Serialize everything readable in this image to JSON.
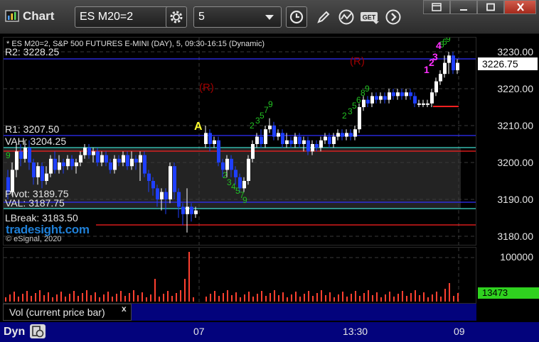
{
  "toolbar": {
    "app_title": "Chart",
    "symbol": "ES M20=2",
    "interval": "5"
  },
  "chart": {
    "instrument": "* ES M20=2, S&P 500 FUTURES E-MINI (DAY), 5, 09:30-16:15 (Dynamic)",
    "levels": {
      "r2": "R2: 3228.25",
      "r1": "R1: 3207.50",
      "vah": "VAH: 3204.25",
      "pivot": "Pivot: 3189.75",
      "val": "VAL: 3187.75",
      "lbreak": "LBreak: 3183.50"
    },
    "watermark": "tradesight.com",
    "copyright": "© eSignal, 2020",
    "price_axis": [
      "3230.00",
      "3220.00",
      "3210.00",
      "3200.00",
      "3190.00",
      "3180.00"
    ],
    "last_price": "3226.75",
    "markers": {
      "a": "A",
      "r_left": "(R)",
      "r_right": "(R)",
      "n1": "1",
      "n2": "2",
      "n3": "3",
      "n4": "4"
    }
  },
  "volume": {
    "label": "Vol (current price bar)",
    "axis_tick": "100000",
    "last_value": "13473",
    "close_glyph": "x"
  },
  "time_axis": {
    "labels": [
      "07",
      "13:30",
      "09"
    ],
    "dyn_label": "Dyn"
  },
  "colors": {
    "up_candle": "#ffffff",
    "down_candle": "#1f3fff",
    "r2_line": "#3030ff",
    "vah_line": "#40e0d0",
    "red_line": "#ff2020",
    "value_area": "#222222",
    "volume": "#ff4030",
    "setup_count": "#22c022",
    "marker_magenta": "#ff30ff",
    "marker_yellow": "#ffff30",
    "marker_dark_red": "#a00000"
  }
}
